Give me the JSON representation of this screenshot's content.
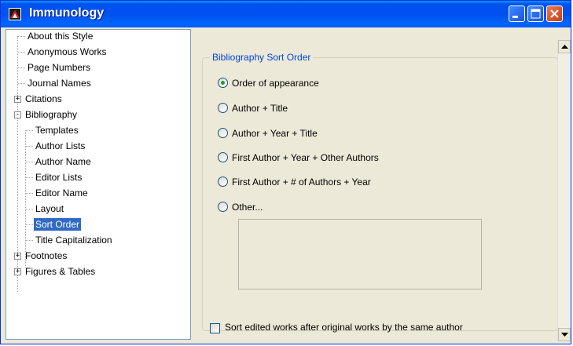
{
  "window": {
    "title": "Immunology",
    "app_icon": "endnote-logo-icon"
  },
  "title_buttons": [
    "minimize-icon",
    "maximize-icon",
    "close-icon"
  ],
  "tree": {
    "items": [
      {
        "label": "About this Style"
      },
      {
        "label": "Anonymous Works"
      },
      {
        "label": "Page Numbers"
      },
      {
        "label": "Journal Names"
      },
      {
        "label": "Citations",
        "expander": "+"
      },
      {
        "label": "Bibliography",
        "expander": "-"
      },
      {
        "label": "Templates"
      },
      {
        "label": "Author Lists"
      },
      {
        "label": "Author Name"
      },
      {
        "label": "Editor Lists"
      },
      {
        "label": "Editor Name"
      },
      {
        "label": "Layout"
      },
      {
        "label": "Sort Order",
        "selected": true
      },
      {
        "label": "Title Capitalization"
      },
      {
        "label": "Footnotes",
        "expander": "+"
      },
      {
        "label": "Figures & Tables",
        "expander": "+"
      }
    ]
  },
  "sort_order": {
    "group_title": "Bibliography Sort Order",
    "options": [
      {
        "label": "Order of appearance",
        "checked": true
      },
      {
        "label": "Author + Title",
        "checked": false
      },
      {
        "label": "Author + Year + Title",
        "checked": false
      },
      {
        "label": "First Author + Year + Other Authors",
        "checked": false
      },
      {
        "label": "First Author + # of Authors + Year",
        "checked": false
      },
      {
        "label": "Other...",
        "checked": false
      }
    ],
    "other_field_value": "",
    "checkbox_label": "Sort edited works after original works by the same author",
    "checkbox_checked": false
  },
  "colors": {
    "titlebar": "#0053ee",
    "selection": "#316ac5",
    "group_title": "#0046d5",
    "radio_dot": "#21a121"
  }
}
